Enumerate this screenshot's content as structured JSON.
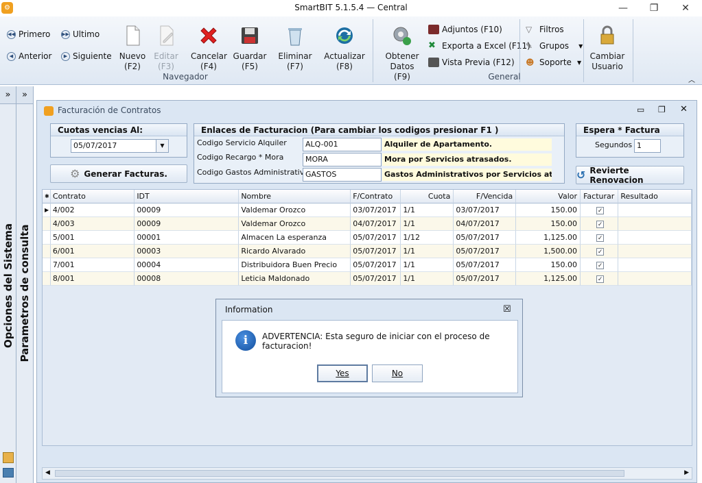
{
  "window": {
    "title": "SmartBIT 5.1.5.4 — Central",
    "min": "—",
    "restore": "❐",
    "close": "✕"
  },
  "ribbon": {
    "nav": {
      "first": "Primero",
      "last": "Ultimo",
      "prev": "Anterior",
      "next": "Siguiente"
    },
    "buttons": [
      {
        "label": "Nuevo\n(F2)",
        "icon": "new-doc-icon"
      },
      {
        "label": "Editar\n(F3)",
        "icon": "edit-icon",
        "disabled": true
      },
      {
        "label": "Cancelar\n(F4)",
        "icon": "cancel-x-icon"
      },
      {
        "label": "Guardar\n(F5)",
        "icon": "floppy-icon"
      },
      {
        "label": "Eliminar\n(F7)",
        "icon": "trash-icon"
      },
      {
        "label": "Actualizar\n(F8)",
        "icon": "refresh-icon"
      },
      {
        "label": "Obtener\nDatos (F9)",
        "icon": "gear-icon"
      }
    ],
    "group_nav": "Navegador",
    "group_general": "General",
    "small": {
      "adjuntos": "Adjuntos (F10)",
      "excel": "Exporta a Excel (F11)",
      "preview": "Vista Previa (F12)",
      "filtros": "Filtros",
      "grupos": "Grupos",
      "soporte": "Soporte"
    },
    "cambiar": "Cambiar\nUsuario"
  },
  "side": {
    "opciones": "Opciones del Sistema",
    "parametros": "Parametros de consulta",
    "expand": "»"
  },
  "form": {
    "title": "Facturación de Contratos",
    "cuotas": {
      "header": "Cuotas vencias Al:",
      "date": "05/07/2017"
    },
    "generar": "Generar Facturas.",
    "enlaces": {
      "header": "Enlaces de Facturacion (Para cambiar los codigos presionar F1 )",
      "rows": [
        {
          "label": "Codigo Servicio Alquiler",
          "code": "ALQ-001",
          "desc": "Alquiler de Apartamento."
        },
        {
          "label": "Codigo Recargo * Mora",
          "code": "MORA",
          "desc": "Mora por Servicios atrasados."
        },
        {
          "label": "Codigo Gastos Administrativos",
          "code": "GASTOS",
          "desc": "Gastos Administrativos por Servicios atrasa"
        }
      ]
    },
    "espera": {
      "header": "Espera * Factura",
      "label": "Segundos",
      "value": "1"
    },
    "revierte": "Revierte Renovacion"
  },
  "grid": {
    "columns": [
      "Contrato",
      "IDT",
      "Nombre",
      "F/Contrato",
      "Cuota",
      "F/Vencida",
      "Valor",
      "Facturar",
      "Resultado"
    ],
    "rows": [
      [
        "4/002",
        "00009",
        "Valdemar Orozco",
        "03/07/2017",
        "1/1",
        "03/07/2017",
        "150.00"
      ],
      [
        "4/003",
        "00009",
        "Valdemar Orozco",
        "04/07/2017",
        "1/1",
        "04/07/2017",
        "150.00"
      ],
      [
        "5/001",
        "00001",
        "Almacen La esperanza",
        "05/07/2017",
        "1/12",
        "05/07/2017",
        "1,125.00"
      ],
      [
        "6/001",
        "00003",
        "Ricardo Alvarado",
        "05/07/2017",
        "1/1",
        "05/07/2017",
        "1,500.00"
      ],
      [
        "7/001",
        "00004",
        "Distribuidora Buen Precio",
        "05/07/2017",
        "1/1",
        "05/07/2017",
        "150.00"
      ],
      [
        "8/001",
        "00008",
        "Leticia Maldonado",
        "05/07/2017",
        "1/1",
        "05/07/2017",
        "1,125.00"
      ]
    ]
  },
  "dialog": {
    "title": "Information",
    "message": "ADVERTENCIA: Esta seguro de iniciar con el proceso de facturacion!",
    "yes": "Yes",
    "no": "No",
    "close": "☒"
  }
}
